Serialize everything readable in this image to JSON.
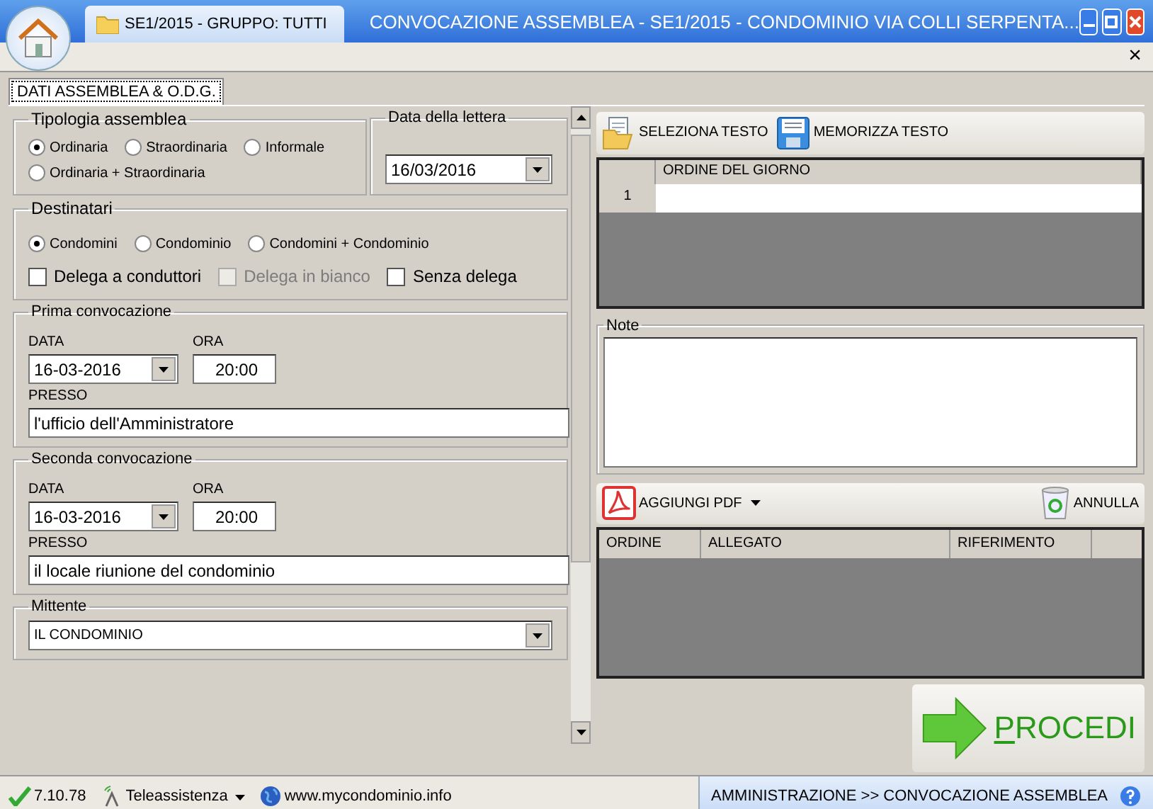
{
  "window": {
    "document_tab": "SE1/2015 - GRUPPO: TUTTI",
    "title": "CONVOCAZIONE ASSEMBLEA - SE1/2015 - CONDOMINIO VIA COLLI SERPENTA...",
    "close_glyph": "×"
  },
  "tabs": [
    {
      "label": "DATI ASSEMBLEA & O.D.G.",
      "selected": true
    }
  ],
  "tipologia": {
    "label": "Tipologia assemblea",
    "options": [
      {
        "label": "Ordinaria",
        "selected": true
      },
      {
        "label": "Straordinaria",
        "selected": false
      },
      {
        "label": "Informale",
        "selected": false
      },
      {
        "label": "Ordinaria + Straordinaria",
        "selected": false
      }
    ]
  },
  "data_lettera": {
    "label": "Data della lettera",
    "value": "16/03/2016"
  },
  "destinatari": {
    "label": "Destinatari",
    "options": [
      {
        "label": "Condomini",
        "selected": true
      },
      {
        "label": "Condominio",
        "selected": false
      },
      {
        "label": "Condomini + Condominio",
        "selected": false
      }
    ],
    "checkboxes": [
      {
        "label": "Delega a conduttori",
        "checked": false,
        "disabled": false
      },
      {
        "label": "Delega in bianco",
        "checked": false,
        "disabled": true
      },
      {
        "label": "Senza delega",
        "checked": false,
        "disabled": false
      }
    ]
  },
  "convocazioni": [
    {
      "label": "Prima convocazione",
      "data_label": "DATA",
      "data_value": "16-03-2016",
      "ora_label": "ORA",
      "ora_value": "20:00",
      "presso_label": "PRESSO",
      "presso_value": "l'ufficio dell'Amministratore"
    },
    {
      "label": "Seconda convocazione",
      "data_label": "DATA",
      "data_value": "16-03-2016",
      "ora_label": "ORA",
      "ora_value": "20:00",
      "presso_label": "PRESSO",
      "presso_value": "il locale riunione del condominio"
    }
  ],
  "mittente": {
    "label": "Mittente",
    "value": "IL CONDOMINIO"
  },
  "text_toolbar": [
    {
      "kind": "open",
      "label": "SELEZIONA TESTO"
    },
    {
      "kind": "save",
      "label": "MEMORIZZA TESTO"
    }
  ],
  "agenda_table": {
    "columns": [
      "ORDINE DEL GIORNO"
    ],
    "rows": [
      {
        "number": "1"
      }
    ]
  },
  "note": {
    "label": "Note"
  },
  "attachments_toolbar": [
    {
      "kind": "pdf",
      "label": "AGGIUNGI PDF",
      "dropdown": true
    },
    {
      "kind": "recycle",
      "label": "ANNULLA",
      "dropdown": false
    }
  ],
  "attachments_table": {
    "columns": [
      "ORDINE",
      "ALLEGATO",
      "RIFERIMENTO"
    ]
  },
  "procedi": {
    "label": "PROCEDI"
  },
  "status_bar": {
    "items": [
      {
        "kind": "check",
        "label": "7.10.78"
      },
      {
        "kind": "remote",
        "label": "Teleassistenza"
      },
      {
        "kind": "globe",
        "label": "www.mycondominio.info"
      }
    ],
    "breadcrumb": "AMMINISTRAZIONE >> CONVOCAZIONE ASSEMBLEA"
  }
}
